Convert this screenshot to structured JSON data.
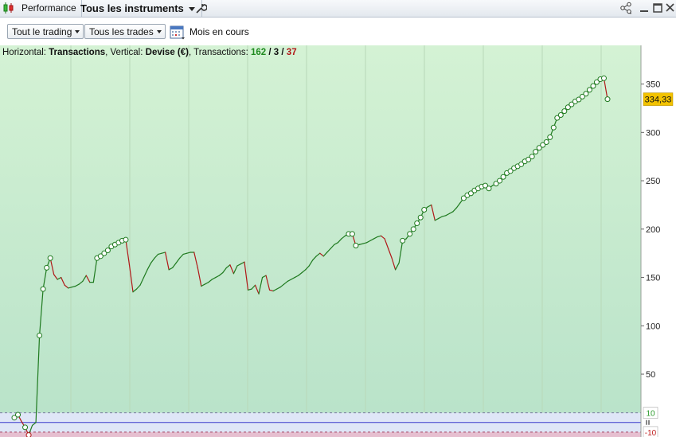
{
  "tabs": {
    "performance_label": "Performance",
    "instruments_label": "Tous les instruments"
  },
  "toolbar": {
    "trading_filter": "Tout le trading",
    "trades_filter": "Tous les trades",
    "period_label": "Mois en cours"
  },
  "info": {
    "horizontal_label": "Horizontal:",
    "horizontal_value": "Transactions",
    "vertical_label": "Vertical:",
    "vertical_value": "Devise (€)",
    "transactions_label": "Transactions:",
    "winning": "162",
    "neutral": "3",
    "losing": "37",
    "separator": "/"
  },
  "colors": {
    "profit_line": "#1f7a1f",
    "loss_line": "#b01818",
    "plot_bg_top": "#d3f2d3",
    "plot_bg_bottom": "#b9e2c9",
    "current_badge": "#f2c200"
  },
  "chart_data": {
    "type": "line",
    "title": "",
    "xlabel": "Transactions",
    "ylabel": "Devise (€)",
    "ylim": [
      -15,
      390
    ],
    "yticks": [
      "350",
      "300",
      "250",
      "200",
      "150",
      "100",
      "50"
    ],
    "threshold_labels": [
      "10",
      "-10"
    ],
    "thresholds": [
      10,
      -10
    ],
    "current_value_label": "334,33",
    "current_value": 334.33,
    "series": [
      {
        "values": [
          5,
          8,
          1,
          -5,
          -13,
          -3,
          0,
          90,
          138,
          160,
          170,
          153,
          148,
          150,
          142,
          139,
          140,
          141,
          143,
          146,
          152,
          145,
          145,
          170,
          172,
          175,
          178,
          182,
          184,
          186,
          188,
          189,
          163,
          135,
          138,
          142,
          150,
          158,
          165,
          170,
          174,
          175,
          176,
          158,
          160,
          165,
          170,
          174,
          175,
          176,
          176,
          160,
          141,
          143,
          145,
          148,
          150,
          152,
          155,
          160,
          163,
          154,
          162,
          164,
          166,
          137,
          138,
          142,
          133,
          150,
          152,
          137,
          136,
          138,
          140,
          143,
          146,
          148,
          150,
          152,
          155,
          158,
          162,
          168,
          172,
          175,
          172,
          176,
          180,
          184,
          186,
          190,
          193,
          195,
          195,
          183,
          184,
          185,
          186,
          188,
          190,
          192,
          193,
          190,
          180,
          170,
          158,
          165,
          188,
          190,
          195,
          200,
          206,
          212,
          220,
          223,
          225,
          209,
          211,
          213,
          214,
          216,
          218,
          222,
          227,
          232,
          235,
          237,
          240,
          242,
          244,
          245,
          242,
          245,
          247,
          250,
          254,
          258,
          260,
          263,
          265,
          267,
          270,
          272,
          275,
          280,
          284,
          287,
          290,
          295,
          305,
          315,
          318,
          322,
          326,
          329,
          332,
          334,
          337,
          340,
          344,
          348,
          352,
          355,
          356,
          334.33
        ],
        "markers": [
          0,
          1,
          3,
          4,
          7,
          8,
          9,
          10,
          23,
          24,
          25,
          26,
          27,
          28,
          29,
          30,
          31,
          93,
          94,
          95,
          108,
          110,
          111,
          112,
          113,
          114,
          125,
          126,
          127,
          128,
          129,
          130,
          131,
          132,
          134,
          135,
          136,
          137,
          138,
          139,
          140,
          141,
          142,
          143,
          144,
          145,
          146,
          147,
          148,
          149,
          150,
          151,
          152,
          153,
          154,
          155,
          156,
          157,
          158,
          159,
          160,
          161,
          162,
          163,
          164,
          165,
          166
        ]
      }
    ]
  }
}
